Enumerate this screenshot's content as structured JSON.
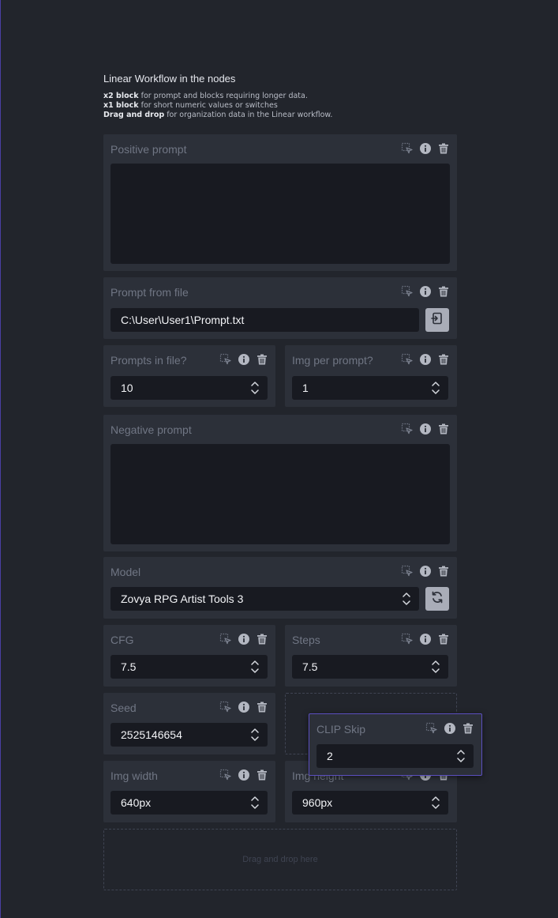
{
  "intro": {
    "title": "Linear Workflow in the nodes",
    "lines": [
      {
        "bold": "x2 block",
        "rest": " for prompt and blocks requiring longer data."
      },
      {
        "bold": "x1 block",
        "rest": " for short numeric values or switches"
      },
      {
        "bold": "Drag and drop",
        "rest": " for organization data in the Linear workflow."
      }
    ]
  },
  "blocks": {
    "positive_prompt": {
      "label": "Positive prompt",
      "value": ""
    },
    "prompt_from_file": {
      "label": "Prompt from file",
      "value": "C:\\User\\User1\\Prompt.txt"
    },
    "prompts_in_file": {
      "label": "Prompts in file?",
      "value": "10"
    },
    "img_per_prompt": {
      "label": "Img per prompt?",
      "value": "1"
    },
    "negative_prompt": {
      "label": "Negative prompt",
      "value": ""
    },
    "model": {
      "label": "Model",
      "value": "Zovya RPG Artist Tools 3"
    },
    "cfg": {
      "label": "CFG",
      "value": "7.5"
    },
    "steps": {
      "label": "Steps",
      "value": "7.5"
    },
    "seed": {
      "label": "Seed",
      "value": "2525146654"
    },
    "clip_skip": {
      "label": "CLIP Skip",
      "value": "2"
    },
    "img_width": {
      "label": "Img width",
      "value": "640px"
    },
    "img_height": {
      "label": "Img height",
      "value": "960px"
    }
  },
  "dropzone": {
    "text": "Drag and drop here"
  },
  "icons": {
    "select": "select-area-icon",
    "info": "info-icon",
    "delete": "trash-icon",
    "file_browse": "file-browse-icon",
    "refresh": "refresh-icon",
    "stepper": "chevron-up-down-icon"
  },
  "colors": {
    "background": "#22252c",
    "card": "#2c3039",
    "field": "#181a21",
    "accent": "#5b4fbf"
  }
}
